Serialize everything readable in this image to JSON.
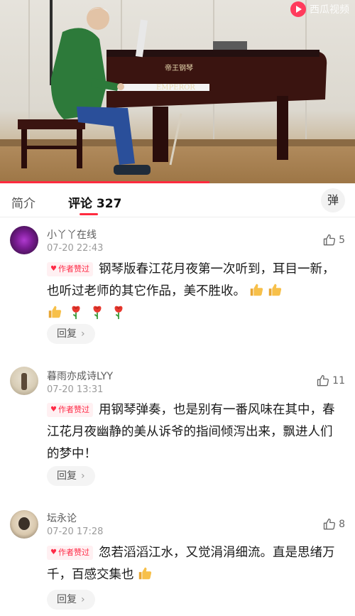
{
  "video": {
    "watermark_text": "西瓜视频",
    "piano_brand_cn": "帝王钢琴",
    "piano_brand_en": "EMPEROR",
    "progress_fraction": 0.59,
    "accent_color": "#ff2b3f"
  },
  "tabs": {
    "intro_label": "简介",
    "comments_label": "评论 327",
    "danmaku_label": "弹"
  },
  "comments": [
    {
      "username": "小丫丫在线",
      "time": "07-20 22:43",
      "likes": "5",
      "badge": "作者赞过",
      "text": "钢琴版春江花月夜第一次听到，耳目一新，也听过老师的其它作品，美不胜收。",
      "reply_label": "回复"
    },
    {
      "username": "暮雨亦成诗LYY",
      "time": "07-20 13:31",
      "likes": "11",
      "badge": "作者赞过",
      "text": "用钢琴弹奏，也是别有一番风味在其中，春江花月夜幽静的美从诉爷的指间倾泻出来，飘进人们的梦中！",
      "reply_label": "回复"
    },
    {
      "username": "坛永论",
      "time": "07-20 17:28",
      "likes": "8",
      "badge": "作者赞过",
      "text": "忽若滔滔江水，又觉涓涓细流。直是思绪万千，百感交集也",
      "reply_label": "回复"
    }
  ],
  "icons": {
    "like": "thumbs-up-outline-icon",
    "thumbs_emoji": "thumbs-up-emoji-icon",
    "rose_emoji": "rose-emoji-icon",
    "heart": "heart-icon",
    "chevron": "chevron-right-icon"
  }
}
